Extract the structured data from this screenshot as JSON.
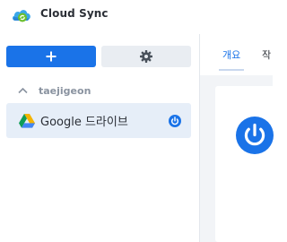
{
  "app": {
    "title": "Cloud Sync",
    "icon": "cloud-sync-app-icon"
  },
  "sidebar": {
    "add_button": {
      "label": "+",
      "icon": "plus-icon"
    },
    "settings_button": {
      "icon": "gear-icon"
    },
    "group": {
      "name": "taejigeon",
      "expanded": true,
      "icon": "chevron-up-icon"
    },
    "connections": [
      {
        "label": "Google 드라이브",
        "icon": "google-drive-icon",
        "status_icon": "power-icon",
        "selected": true
      }
    ]
  },
  "main": {
    "tabs": [
      {
        "label": "개요",
        "active": true
      },
      {
        "label": "작"
      }
    ],
    "status_icon": "power-icon"
  },
  "colors": {
    "accent": "#1a73e8",
    "selected_bg": "#e6eef8",
    "settings_bg": "#e9edf2",
    "panel_bg": "#f2f4f7"
  }
}
